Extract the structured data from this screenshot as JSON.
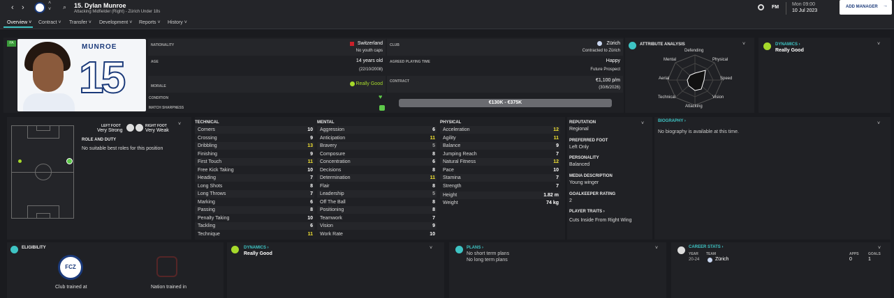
{
  "topbar": {
    "player_title": "15. Dylan Munroe",
    "player_sub": "Attacking Midfielder (Right) - Zürich Under 18s",
    "fm": "FM",
    "day": "Mon 09:00",
    "date": "10 Jul 2023",
    "add_manager": "ADD MANAGER"
  },
  "tabs": [
    {
      "label": "Overview"
    },
    {
      "label": "Contract"
    },
    {
      "label": "Transfer"
    },
    {
      "label": "Development"
    },
    {
      "label": "Reports"
    },
    {
      "label": "History"
    }
  ],
  "header": {
    "badge": "PA",
    "shirt_name": "MUNROE",
    "shirt_number": "15",
    "nationality_label": "NATIONALITY",
    "nationality_value": "Switzerland",
    "nationality_sub": "No youth caps",
    "age_label": "AGE",
    "age_value": "14 years old",
    "age_sub": "(22/10/2008)",
    "morale_label": "MORALE",
    "morale_value": "Really Good",
    "condition_label": "CONDITION",
    "sharpness_label": "MATCH SHARPNESS",
    "club_label": "CLUB",
    "club_value": "Zürich",
    "club_sub": "Contracted to Zürich",
    "playing_time_label": "AGREED PLAYING TIME",
    "playing_time_value": "Happy",
    "playing_time_sub": "Future Prospect",
    "contract_label": "CONTRACT",
    "contract_value": "€1,100 p/m",
    "contract_sub": "(30/6/2026)",
    "value_range": "€130K - €375K"
  },
  "attribute_analysis": {
    "title": "ATTRIBUTE ANALYSIS",
    "axes": [
      "Defending",
      "Physical",
      "Speed",
      "Vision",
      "Attacking",
      "Technical",
      "Aerial",
      "Mental"
    ]
  },
  "dynamics_top": {
    "title": "DYNAMICS",
    "value": "Really Good"
  },
  "position": {
    "left_foot_label": "LEFT FOOT",
    "left_foot_value": "Very Strong",
    "right_foot_label": "RIGHT FOOT",
    "right_foot_value": "Very Weak",
    "role_title": "ROLE AND DUTY",
    "role_text": "No suitable best roles for this position"
  },
  "technical": {
    "title": "TECHNICAL",
    "rows": [
      {
        "n": "Corners",
        "v": "10"
      },
      {
        "n": "Crossing",
        "v": "9"
      },
      {
        "n": "Dribbling",
        "v": "13"
      },
      {
        "n": "Finishing",
        "v": "9"
      },
      {
        "n": "First Touch",
        "v": "11"
      },
      {
        "n": "Free Kick Taking",
        "v": "10"
      },
      {
        "n": "Heading",
        "v": "7"
      },
      {
        "n": "Long Shots",
        "v": "8"
      },
      {
        "n": "Long Throws",
        "v": "7"
      },
      {
        "n": "Marking",
        "v": "6"
      },
      {
        "n": "Passing",
        "v": "8"
      },
      {
        "n": "Penalty Taking",
        "v": "10"
      },
      {
        "n": "Tackling",
        "v": "6"
      },
      {
        "n": "Technique",
        "v": "11"
      }
    ]
  },
  "mental": {
    "title": "MENTAL",
    "rows": [
      {
        "n": "Aggression",
        "v": "6"
      },
      {
        "n": "Anticipation",
        "v": "11"
      },
      {
        "n": "Bravery",
        "v": "5"
      },
      {
        "n": "Composure",
        "v": "8"
      },
      {
        "n": "Concentration",
        "v": "6"
      },
      {
        "n": "Decisions",
        "v": "8"
      },
      {
        "n": "Determination",
        "v": "11"
      },
      {
        "n": "Flair",
        "v": "8"
      },
      {
        "n": "Leadership",
        "v": "5"
      },
      {
        "n": "Off The Ball",
        "v": "8"
      },
      {
        "n": "Positioning",
        "v": "8"
      },
      {
        "n": "Teamwork",
        "v": "7"
      },
      {
        "n": "Vision",
        "v": "9"
      },
      {
        "n": "Work Rate",
        "v": "10"
      }
    ]
  },
  "physical": {
    "title": "PHYSICAL",
    "rows": [
      {
        "n": "Acceleration",
        "v": "12"
      },
      {
        "n": "Agility",
        "v": "11"
      },
      {
        "n": "Balance",
        "v": "9"
      },
      {
        "n": "Jumping Reach",
        "v": "7"
      },
      {
        "n": "Natural Fitness",
        "v": "12"
      },
      {
        "n": "Pace",
        "v": "10"
      },
      {
        "n": "Stamina",
        "v": "7"
      },
      {
        "n": "Strength",
        "v": "7"
      }
    ],
    "height_label": "Height",
    "height_value": "1.82 m",
    "weight_label": "Weight",
    "weight_value": "74 kg"
  },
  "info": {
    "reputation_label": "REPUTATION",
    "reputation_value": "Regional",
    "foot_label": "PREFERRED FOOT",
    "foot_value": "Left Only",
    "personality_label": "PERSONALITY",
    "personality_value": "Balanced",
    "media_label": "MEDIA DESCRIPTION",
    "media_value": "Young winger",
    "gk_label": "GOALKEEPER RATING",
    "gk_value": "2",
    "traits_label": "PLAYER TRAITS",
    "traits_value": "Cuts Inside From Right Wing"
  },
  "biography": {
    "title": "BIOGRAPHY",
    "text": "No biography is available at this time."
  },
  "eligibility": {
    "title": "ELIGIBILITY",
    "club_logo": "FCZ",
    "club_caption": "Club trained at",
    "nation_caption": "Nation trained in"
  },
  "dynamics_bottom": {
    "title": "DYNAMICS",
    "value": "Really Good"
  },
  "plans": {
    "title": "PLANS",
    "short": "No short term plans",
    "long": "No long term plans"
  },
  "career": {
    "title": "CAREER STATS",
    "year_h": "YEAR",
    "team_h": "TEAM",
    "apps_h": "APPS",
    "goals_h": "GOALS",
    "year": "20-24",
    "team": "Zürich",
    "apps": "0",
    "goals": "1"
  },
  "colors": {
    "accent": "#3ec4c4",
    "yellow": "#f2e233",
    "green": "#5ec94a",
    "lime": "#a6d92b"
  }
}
